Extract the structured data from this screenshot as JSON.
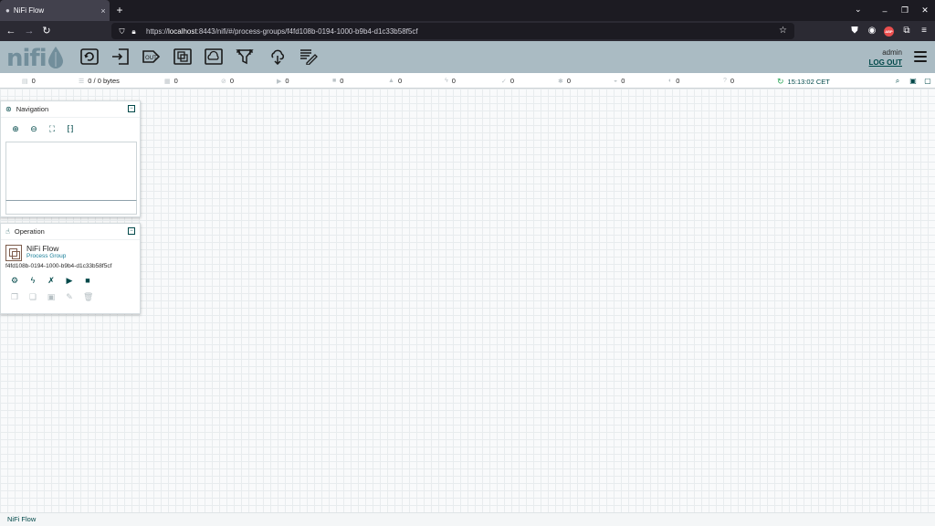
{
  "browser": {
    "tab_title": "NiFi Flow",
    "tab_close": "×",
    "new_tab": "+",
    "url_prefix": "https://",
    "url_host": "localhost",
    "url_rest": ":8443/nifi/#/process-groups/f4fd108b-0194-1000-b9b4-d1c33b58f5cf",
    "abp_label": "ABP"
  },
  "header": {
    "logo_text": "nifi",
    "user_name": "admin",
    "logout_label": "LOG OUT"
  },
  "toolbar": {
    "components": [
      "processor",
      "input-port",
      "output-port",
      "process-group",
      "remote-process-group",
      "funnel",
      "template",
      "label"
    ]
  },
  "status_bar": {
    "active_threads": "0",
    "queued": "0 / 0 bytes",
    "transmitting": "0",
    "not_transmitting": "0",
    "running": "0",
    "stopped": "0",
    "invalid": "0",
    "disabled": "0",
    "up_to_date": "0",
    "locally_modified": "0",
    "stale": "0",
    "locally_modified_stale": "0",
    "sync_failure": "0",
    "last_refreshed": "15:13:02 CET"
  },
  "navigation": {
    "title": "Navigation",
    "collapse": "−"
  },
  "operation": {
    "title": "Operation",
    "collapse": "−",
    "selection_name": "NiFi Flow",
    "selection_type": "Process Group",
    "selection_id": "f4fd108b-0194-1000-b9b4-d1c33b58f5cf"
  },
  "breadcrumb": {
    "label": "NiFi Flow"
  },
  "colors": {
    "header_bg": "#aabbc3",
    "accent": "#004849",
    "logo": "#728e9b"
  }
}
